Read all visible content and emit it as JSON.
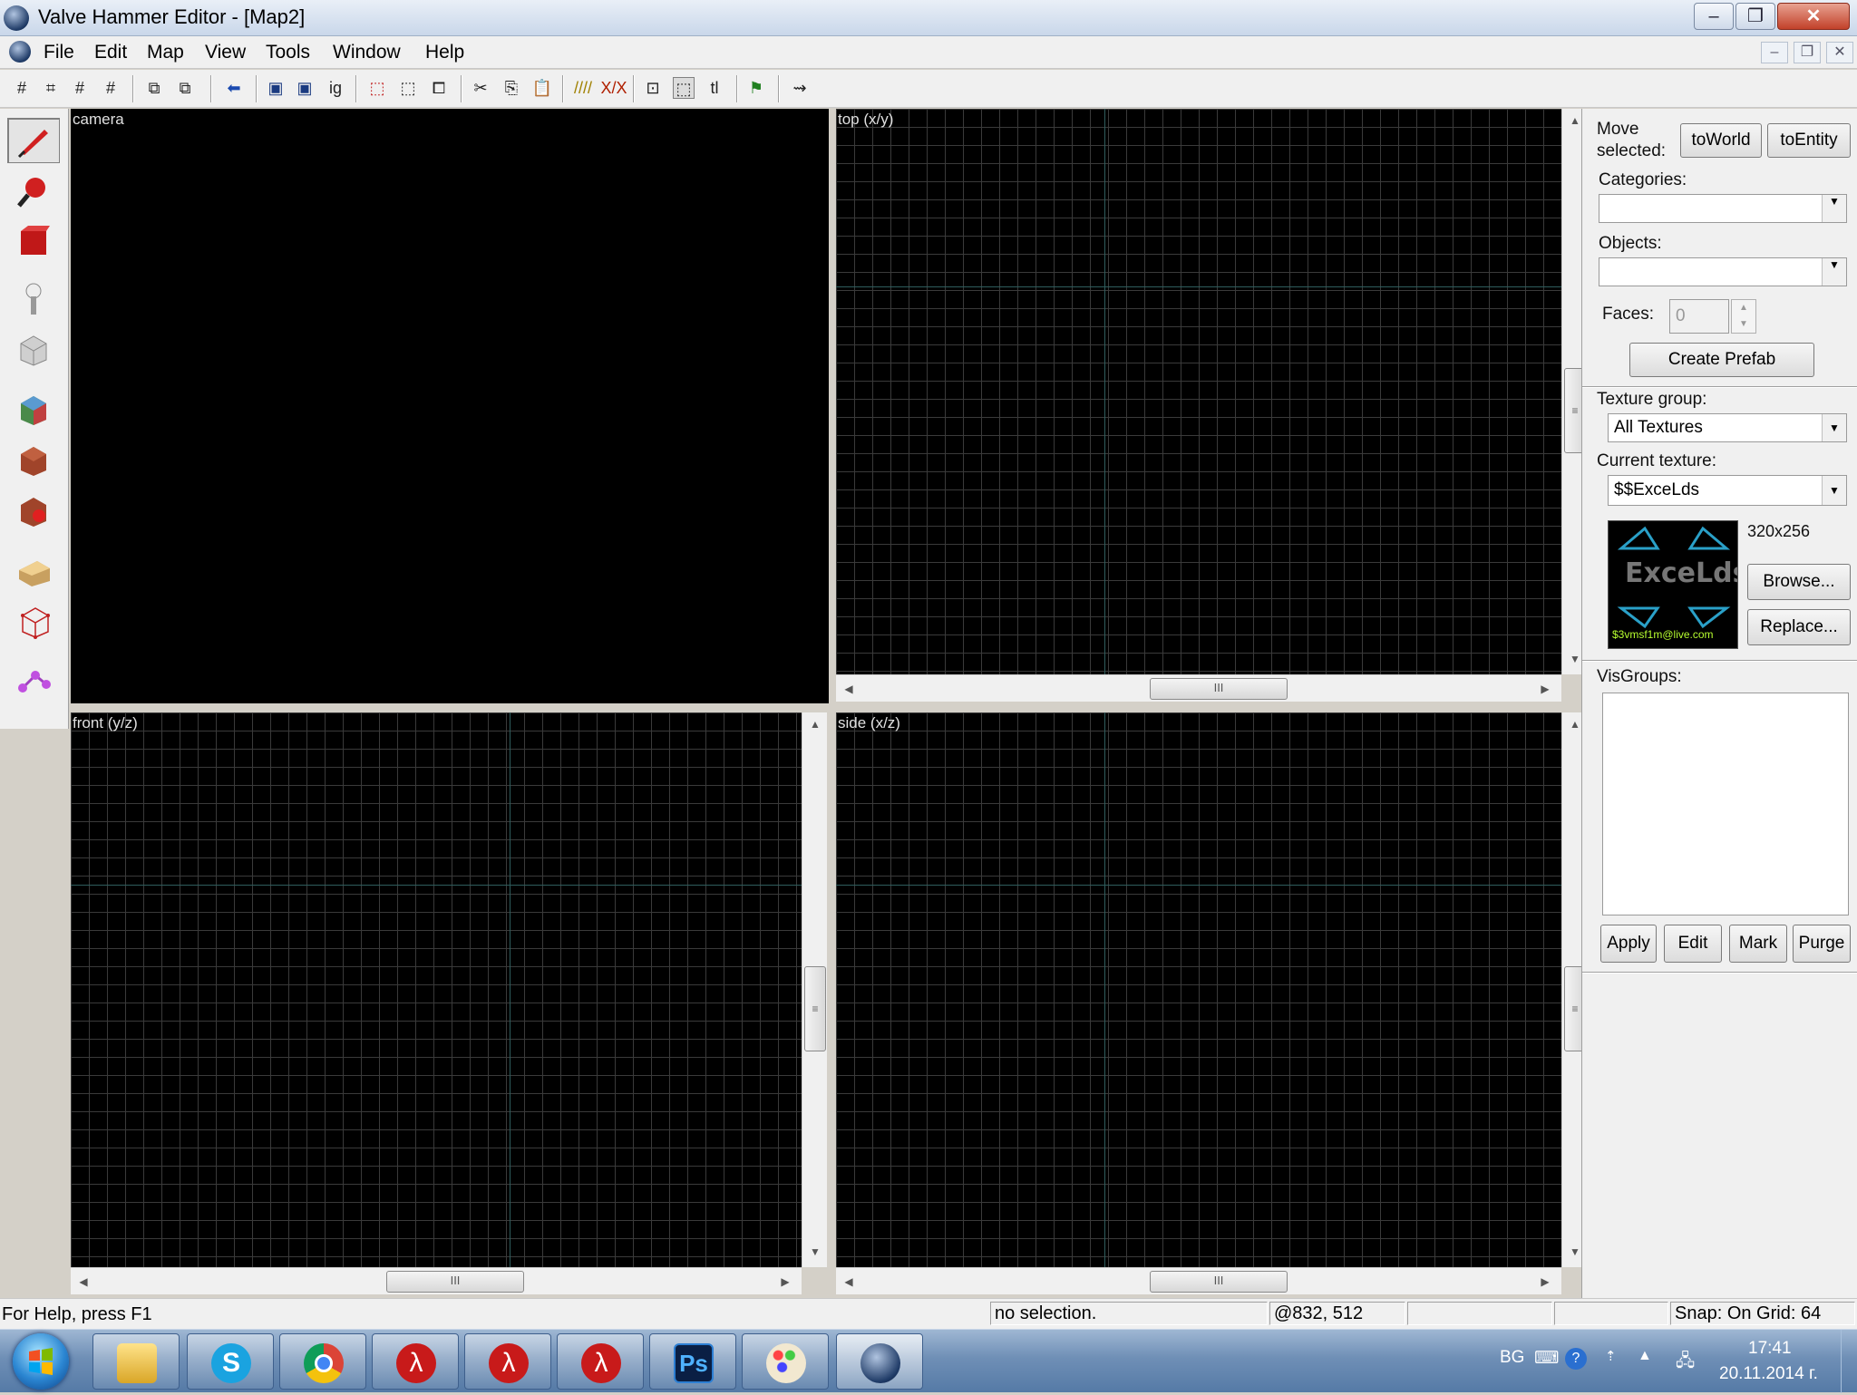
{
  "window": {
    "title": "Valve Hammer Editor - [Map2]",
    "minimize": "–",
    "maximize": "❐",
    "close": "✕"
  },
  "menu": {
    "items": [
      "File",
      "Edit",
      "Map",
      "View",
      "Tools",
      "Window",
      "Help"
    ],
    "mdi_minimize": "–",
    "mdi_restore": "❐",
    "mdi_close": "✕"
  },
  "viewports": {
    "camera": "camera",
    "top": "top (x/y)",
    "front": "front (y/z)",
    "side": "side (x/z)"
  },
  "right_panel": {
    "move_selected_line1": "Move",
    "move_selected_line2": "selected:",
    "to_world": "toWorld",
    "to_entity": "toEntity",
    "categories_label": "Categories:",
    "categories_value": "",
    "objects_label": "Objects:",
    "objects_value": "",
    "faces_label": "Faces:",
    "faces_value": "0",
    "create_prefab": "Create Prefab",
    "texture_group_label": "Texture group:",
    "texture_group_value": "All Textures",
    "current_texture_label": "Current texture:",
    "current_texture_value": "$$ExceLds",
    "texture_size": "320x256",
    "texture_logo_text": "ExceLds",
    "texture_email_text": "$3vmsf1m@live.com",
    "browse": "Browse...",
    "replace": "Replace...",
    "visgroups_label": "VisGroups:",
    "apply": "Apply",
    "edit": "Edit",
    "mark": "Mark",
    "purge": "Purge"
  },
  "status": {
    "help": "For Help, press F1",
    "selection": "no selection.",
    "coords": "@832, 512",
    "snap": "Snap: On Grid: 64"
  },
  "taskbar": {
    "language": "BG",
    "time": "17:41",
    "date": "20.11.2014 г.",
    "photoshop_label": "Ps",
    "halflife_glyph": "λ"
  },
  "colors": {
    "viewport_bg": "#000000",
    "grid_line": "#3a3a3a",
    "axis_line": "#2f5d5d",
    "panel_bg": "#f0f0f0",
    "taskbar": "#6f8fb6"
  }
}
